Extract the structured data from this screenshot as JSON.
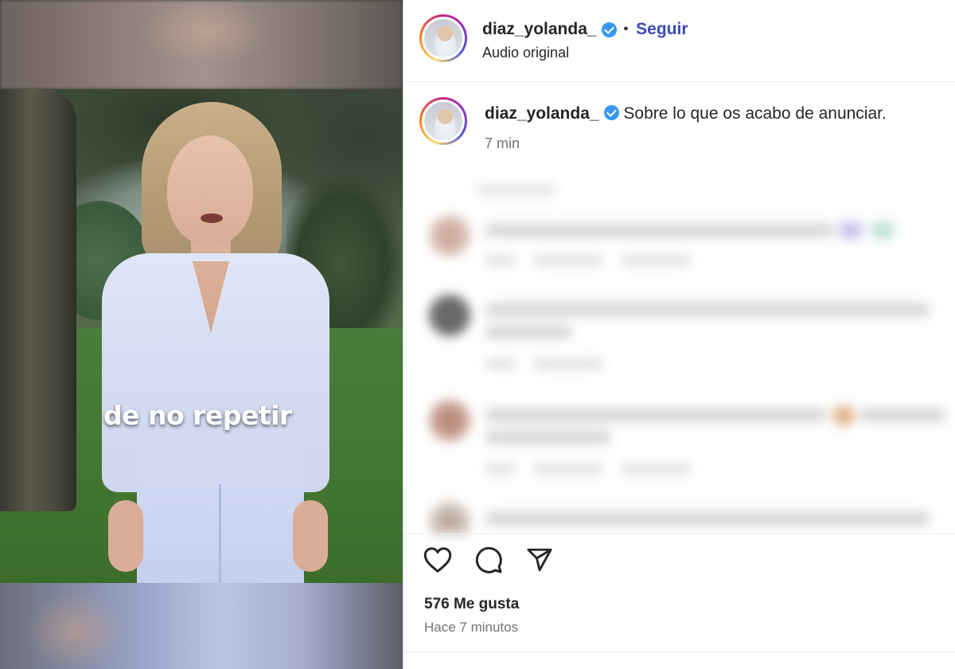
{
  "video": {
    "caption": "de no repetir"
  },
  "header": {
    "username": "diaz_yolanda_",
    "follow_label": "Seguir",
    "audio_label": "Audio original",
    "separator": "•"
  },
  "post": {
    "username": "diaz_yolanda_",
    "caption_text": "Sobre lo que os acabo de anunciar.",
    "time": "7 min"
  },
  "icons": {
    "verified": "verified-badge-icon",
    "like": "heart-icon",
    "comment": "comment-icon",
    "share": "send-icon"
  },
  "stats": {
    "likes": "576 Me gusta",
    "ago": "Hace 7 minutos"
  },
  "colors": {
    "follow": "#3b4bb5",
    "verified": "#3897f0",
    "muted": "#737373"
  }
}
